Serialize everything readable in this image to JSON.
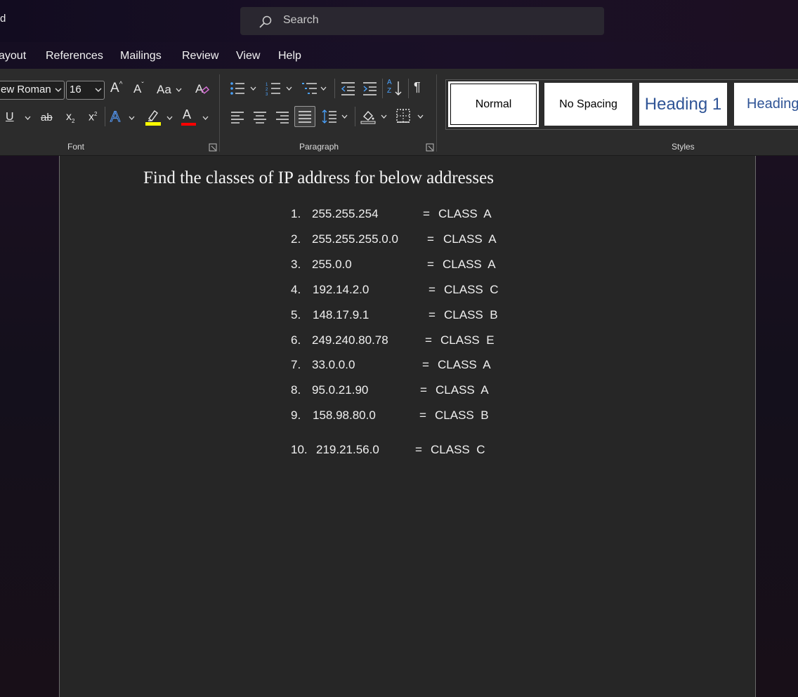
{
  "title_fragment": "d",
  "search": {
    "label": "Search"
  },
  "menu": [
    "ayout",
    "References",
    "Mailings",
    "Review",
    "View",
    "Help"
  ],
  "font_group": {
    "font_name": "ew Roman",
    "font_size": "16",
    "grow_label": "A",
    "shrink_label": "A",
    "case_label": "Aa",
    "underline_label": "U",
    "strike_label": "ab",
    "subscript_label": "x",
    "subscript_sub": "2",
    "superscript_label": "x",
    "superscript_sup": "2",
    "text_effects_label": "A",
    "font_color_label": "A",
    "highlight_color": "#ffff00",
    "font_color": "#ff0000",
    "group_label": "Font"
  },
  "paragraph_group": {
    "pilcrow": "¶",
    "sort_top": "A",
    "sort_bottom": "Z",
    "group_label": "Paragraph"
  },
  "styles_group": {
    "cards": [
      "Normal",
      "No Spacing",
      "Heading 1",
      "Heading"
    ],
    "heading_color": "#2f5496",
    "group_label": "Styles"
  },
  "document": {
    "title": "Find the classes of IP address for below addresses",
    "rows": [
      {
        "num": "1.",
        "addr": "255.255.254",
        "eq": "=",
        "cls": "CLASS  A"
      },
      {
        "num": "2.",
        "addr": "255.255.255.0.0",
        "eq": "=",
        "cls": "CLASS  A"
      },
      {
        "num": "3.",
        "addr": "255.0.0",
        "eq": "=",
        "cls": "CLASS  A"
      },
      {
        "num": "4.",
        "addr": "192.14.2.0",
        "eq": "=",
        "cls": "CLASS  C"
      },
      {
        "num": "5.",
        "addr": "148.17.9.1",
        "eq": "=",
        "cls": "CLASS  B"
      },
      {
        "num": "6.",
        "addr": "249.240.80.78",
        "eq": "=",
        "cls": "CLASS  E"
      },
      {
        "num": "7.",
        "addr": "33.0.0.0",
        "eq": "=",
        "cls": "CLASS  A"
      },
      {
        "num": "8.",
        "addr": "95.0.21.90",
        "eq": "=",
        "cls": "CLASS  A"
      },
      {
        "num": "9.",
        "addr": "158.98.80.0",
        "eq": "=",
        "cls": "CLASS  B"
      },
      {
        "num": "10.",
        "addr": "219.21.56.0",
        "eq": "=",
        "cls": "CLASS  C"
      }
    ]
  }
}
